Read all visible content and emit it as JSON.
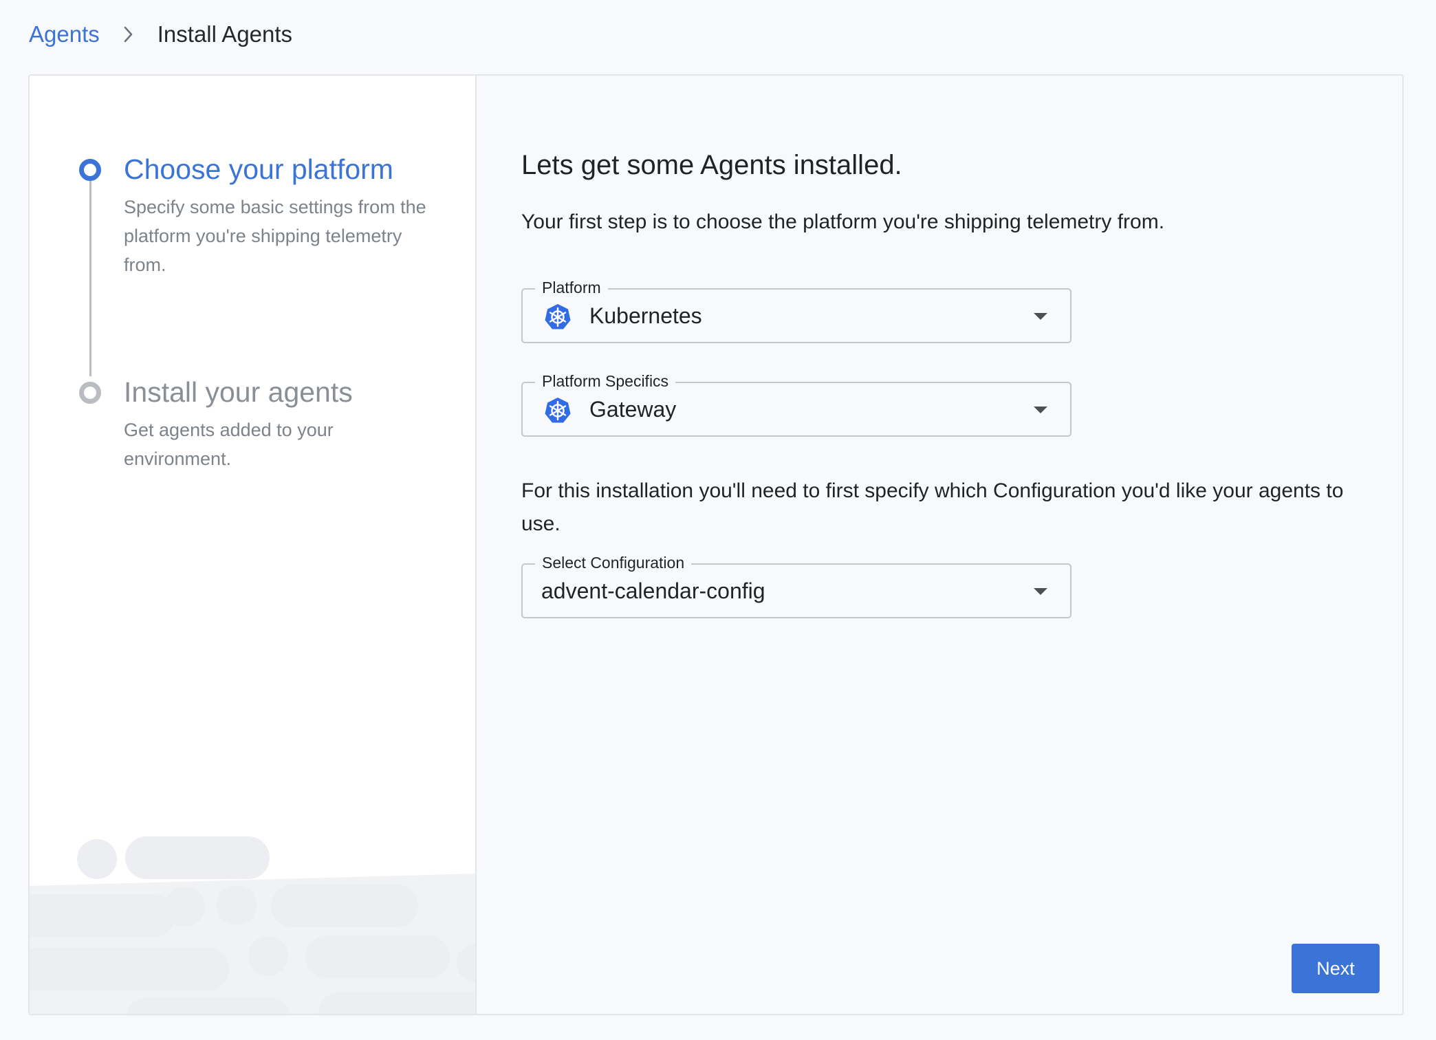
{
  "breadcrumb": {
    "parent": "Agents",
    "current": "Install Agents"
  },
  "stepper": {
    "steps": [
      {
        "title": "Choose your platform",
        "description": "Specify some basic settings from the platform you're shipping telemetry from.",
        "state": "active"
      },
      {
        "title": "Install your agents",
        "description": "Get agents added to your environment.",
        "state": "inactive"
      }
    ]
  },
  "main": {
    "heading": "Lets get some Agents installed.",
    "intro": "Your first step is to choose the platform you're shipping telemetry from.",
    "platform": {
      "label": "Platform",
      "value": "Kubernetes",
      "icon": "kubernetes-icon"
    },
    "platform_specifics": {
      "label": "Platform Specifics",
      "value": "Gateway",
      "icon": "kubernetes-icon"
    },
    "config_note": "For this installation you'll need to first specify which Configuration you'd like your agents to use.",
    "configuration": {
      "label": "Select Configuration",
      "value": "advent-calendar-config"
    },
    "next_label": "Next"
  },
  "colors": {
    "accent": "#3b73d6",
    "inactive": "#b9bcc1",
    "background": "#f8f9fb"
  }
}
